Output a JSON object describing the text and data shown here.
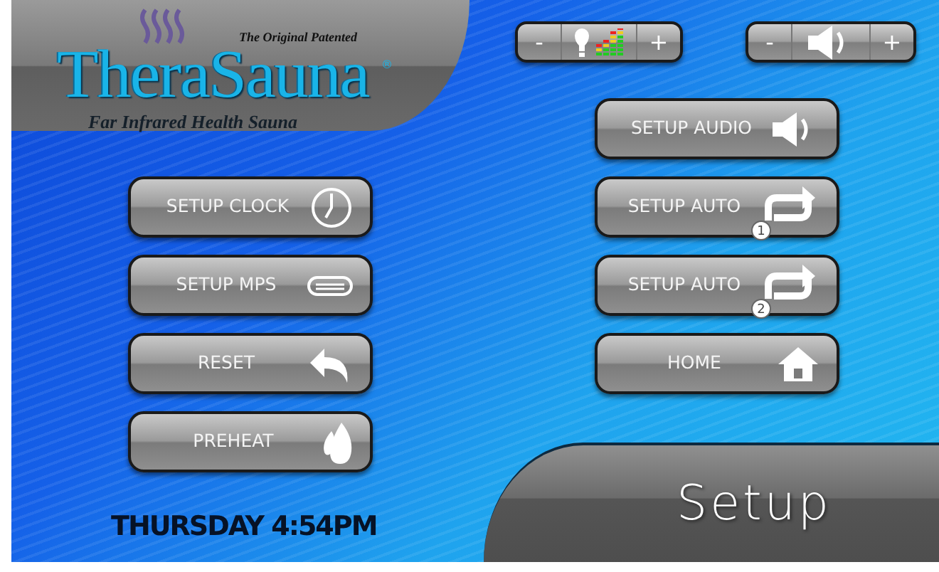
{
  "brand": {
    "name": "TheraSauna",
    "trademark": "®",
    "tagline": "The Original Patented",
    "subtitle": "Far Infrared Health Sauna"
  },
  "top_controls": [
    {
      "kind": "brightness",
      "minus": "-",
      "plus": "+"
    },
    {
      "kind": "volume",
      "minus": "-",
      "plus": "+"
    }
  ],
  "left_buttons": [
    {
      "label": "SETUP CLOCK",
      "kind": "clock"
    },
    {
      "label": "SETUP MPS",
      "kind": "mps"
    },
    {
      "label": "RESET",
      "kind": "reset"
    },
    {
      "label": "PREHEAT",
      "kind": "flame"
    }
  ],
  "clock": "THURSDAY 4:54PM",
  "right_buttons": [
    {
      "label": "SETUP AUDIO",
      "kind": "speaker"
    },
    {
      "label": "SETUP AUTO",
      "kind": "repeat",
      "badge": "1"
    },
    {
      "label": "SETUP AUTO",
      "kind": "repeat",
      "badge": "2"
    },
    {
      "label": "HOME",
      "kind": "home"
    }
  ],
  "screen_title": "Setup"
}
